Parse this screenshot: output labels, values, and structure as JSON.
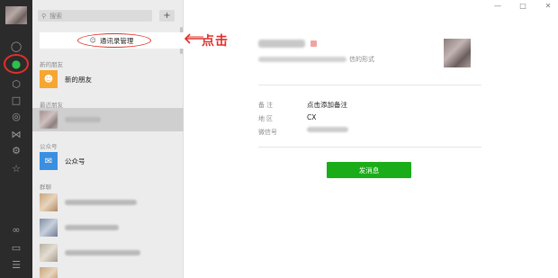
{
  "colors": {
    "accent_green": "#1aad19",
    "annotation_red": "#e0302a",
    "rail_bg": "#2b2b2b",
    "list_bg": "#ececec"
  },
  "search": {
    "placeholder": "搜索",
    "icon": "search-icon"
  },
  "add_button": {
    "label": "+"
  },
  "contacts_manager": {
    "label": "通讯录管理",
    "icon": "contacts-manager-icon"
  },
  "annotation": {
    "text": "点击"
  },
  "sections": {
    "new_friends": "新的朋友",
    "recent": "最近朋友",
    "official": "公众号",
    "group": "群聊"
  },
  "rows": {
    "new_friends": {
      "label": "新的朋友",
      "icon": "person-add-icon"
    },
    "official": {
      "label": "公众号",
      "icon": "official-account-icon"
    }
  },
  "rail_icons": [
    "chat-icon",
    "contacts-icon",
    "cube-icon",
    "folder-icon",
    "eye-icon",
    "butterfly-icon",
    "gear-icon",
    "star-icon",
    "link-icon",
    "phone-icon",
    "menu-icon"
  ],
  "window_controls": [
    "minimize-icon",
    "maximize-icon",
    "close-icon"
  ],
  "detail": {
    "signature_suffix": "信的形式",
    "remark_label": "备注",
    "remark_value": "点击添加备注",
    "region_label": "地区",
    "region_value": "CX",
    "wechat_id_label": "微信号",
    "send_button": "发消息"
  }
}
